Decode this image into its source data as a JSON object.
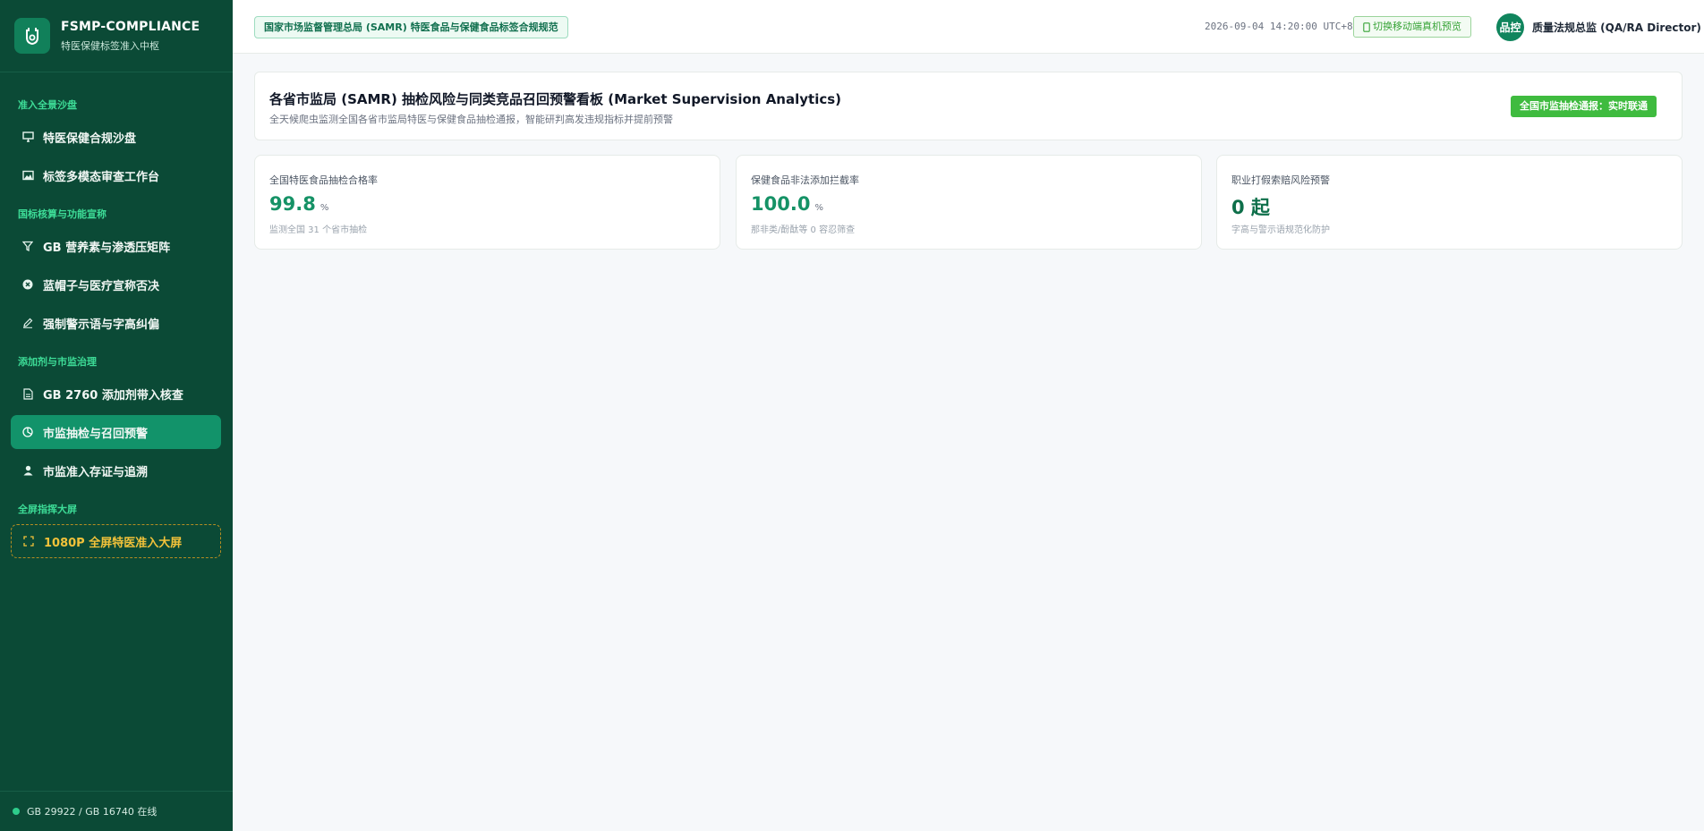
{
  "brand": {
    "title": "FSMP-COMPLIANCE",
    "subtitle": "特医保健标签准入中枢",
    "logo_icon": "shield-logo-icon"
  },
  "sidebar": {
    "sections": [
      {
        "label": "准入全景沙盘"
      },
      {
        "label": "国标核算与功能宣称"
      },
      {
        "label": "添加剂与市监治理"
      },
      {
        "label": "全屏指挥大屏"
      }
    ],
    "items": [
      {
        "label": "特医保健合规沙盘",
        "icon": "desktop-icon"
      },
      {
        "label": "标签多模态审查工作台",
        "icon": "image-icon"
      },
      {
        "label": "GB 营养素与渗透压矩阵",
        "icon": "filter-icon"
      },
      {
        "label": "蓝帽子与医疗宣称否决",
        "icon": "close-circle-icon"
      },
      {
        "label": "强制警示语与字高纠偏",
        "icon": "pen-icon"
      },
      {
        "label": "GB 2760 添加剂带入核查",
        "icon": "document-icon"
      },
      {
        "label": "市监抽检与召回预警",
        "icon": "pie-chart-icon",
        "active": true
      },
      {
        "label": "市监准入存证与追溯",
        "icon": "user-icon"
      },
      {
        "label": "1080P 全屏特医准入大屏",
        "icon": "fullscreen-icon"
      }
    ],
    "footer_status": "GB 29922 / GB 16740 在线",
    "colors": {
      "background": "#0b4a36",
      "active": "#12936a",
      "section": "#3ddc97",
      "screen_accent": "#f2c23a"
    }
  },
  "header": {
    "regulation_badge": "国家市场监督管理总局 (SAMR) 特医食品与保健食品标签合规规范",
    "datetime": "2026-09-04 14:20:00 UTC+8",
    "mobile_preview": "切换移动端真机预览",
    "avatar_text": "品控",
    "user": "质量法规总监 (QA/RA Director)"
  },
  "banner": {
    "title": "各省市监局 (SAMR) 抽检风险与同类竞品召回预警看板 (Market Supervision Analytics)",
    "subtitle": "全天候爬虫监测全国各省市监局特医与保健食品抽检通报，智能研判高发违规指标并提前预警",
    "live_badge": "全国市监抽检通报：实时联通"
  },
  "stats": [
    {
      "label": "全国特医食品抽检合格率",
      "value": "99.8",
      "unit": "%",
      "note": "监测全国 31 个省市抽检"
    },
    {
      "label": "保健食品非法添加拦截率",
      "value": "100.0",
      "unit": "%",
      "note": "那非类/酚酞等 0 容忍筛查"
    },
    {
      "label": "职业打假索赔风险预警",
      "value": "0 起",
      "unit": "",
      "note": "字高与警示语规范化防护"
    }
  ]
}
